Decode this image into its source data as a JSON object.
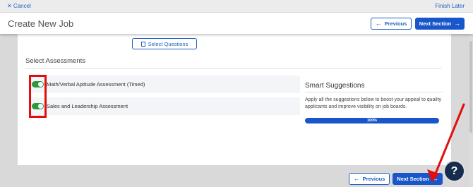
{
  "topbar": {
    "cancel_label": "✕ Cancel",
    "finish_label": "Finish Later"
  },
  "header": {
    "title": "Create New Job",
    "previous_label": "Previous",
    "next_label": "Next Section"
  },
  "questions": {
    "select_label": "Select Questions"
  },
  "assessments": {
    "title": "Select Assessments",
    "items": [
      {
        "label": "Math/Verbal Aptitude Assessment (Timed)",
        "enabled": true
      },
      {
        "label": "Sales and Leadership Assessment",
        "enabled": true
      }
    ]
  },
  "smart": {
    "title": "Smart Suggestions",
    "text": "Apply all the suggestions below to boost your appeal to quality applicants and improve visibility on job boards.",
    "progress_label": "100%",
    "progress_value": 100
  },
  "footer": {
    "previous_label": "Previous",
    "next_label": "Next Section"
  },
  "help": {
    "label": "?"
  },
  "colors": {
    "primary": "#1956c9",
    "toggle_on": "#2b9a3e",
    "highlight": "#e20d0d"
  }
}
